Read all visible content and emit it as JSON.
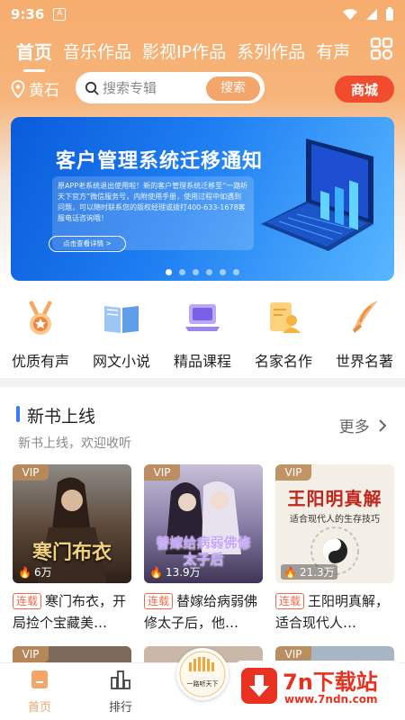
{
  "status_bar": {
    "time": "9:36",
    "a_icon": "A"
  },
  "tabs": [
    "首页",
    "音乐作品",
    "影视IP作品",
    "系列作品",
    "有声"
  ],
  "search": {
    "location": "黄石",
    "placeholder": "搜索专辑",
    "button": "搜索",
    "mall": "商城"
  },
  "banner": {
    "title": "客户管理系统迁移通知",
    "desc": "原APP老系统退出使用啦！新的客户管理系统迁移至“一路听天下官方”微信服务号，内附使用手册，使用过程中如遇到问题，可以随时联系您的版权经理或拨打400-633-1678客服电话咨询哦！",
    "button": "点击查看详情 >",
    "active_dot": 0,
    "dot_count": 6
  },
  "categories": [
    {
      "label": "优质有声",
      "icon": "medal-icon"
    },
    {
      "label": "网文小说",
      "icon": "book-icon"
    },
    {
      "label": "精品课程",
      "icon": "laptop-icon"
    },
    {
      "label": "名家名作",
      "icon": "author-icon"
    },
    {
      "label": "世界名著",
      "icon": "quill-icon"
    }
  ],
  "section": {
    "title": "新书上线",
    "subtitle": "新书上线，欢迎收听",
    "more": "更多"
  },
  "books": [
    {
      "vip": "VIP",
      "plays": "6万",
      "cover_text": "寒门布衣",
      "tag": "连载",
      "title": "寒门布衣，开局捡个宝藏美…",
      "cover_color": "#5b4637"
    },
    {
      "vip": "VIP",
      "plays": "13.9万",
      "cover_text": "替嫁给病弱佛修太子后",
      "tag": "连载",
      "title": "替嫁给病弱佛修太子后，他…",
      "cover_color": "#6f6a8f"
    },
    {
      "vip": "VIP",
      "plays": "21.3万",
      "cover_text": "王阳明真解",
      "cover_sub": "适合现代人的生存技巧",
      "tag": "连载",
      "title": "王阳明真解，适合现代人…",
      "cover_color": "#f3efe6"
    }
  ],
  "bottom_nav": [
    {
      "label": "首页",
      "icon": "home-icon",
      "active": true
    },
    {
      "label": "排行",
      "icon": "ranking-icon",
      "active": false
    }
  ],
  "player_label": "一路听天下",
  "watermark": {
    "name": "7n下载站",
    "url": "www.7ndn.com"
  },
  "colors": {
    "accent": "#f3a56a",
    "mall": "#f24c2f",
    "tag": "#f06a4a",
    "section_bar": "#3b7cf0"
  }
}
